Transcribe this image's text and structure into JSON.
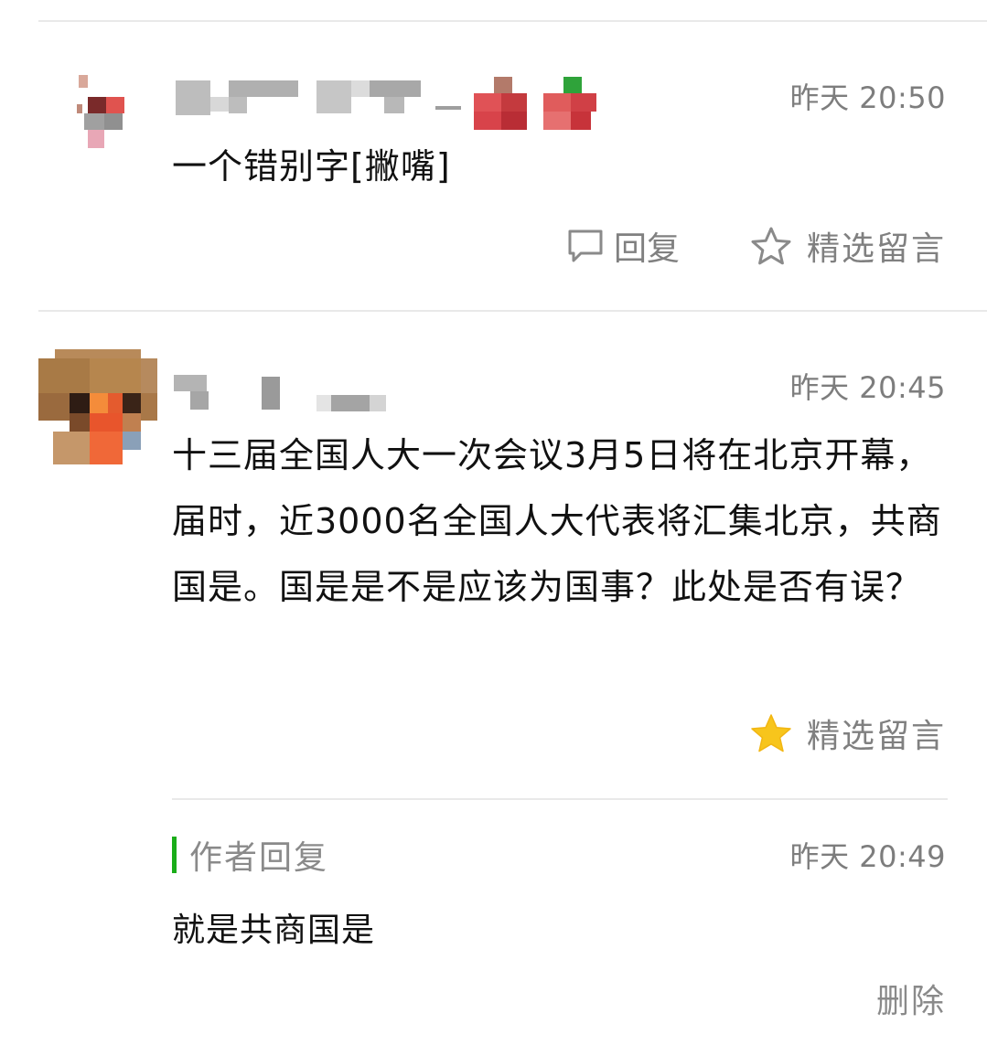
{
  "colors": {
    "background": "#ffffff",
    "text_primary": "#111111",
    "text_secondary": "#808080",
    "accent_green": "#1aad19",
    "star_gold": "#f7c51c",
    "divider": "#e9e9e9"
  },
  "comments": [
    {
      "author_name_blurred": true,
      "time": "昨天 20:50",
      "content": "一个错别字[撇嘴]",
      "actions": {
        "reply_label": "回复",
        "reply_icon": "comment-bubble-icon",
        "feature_label": "精选留言",
        "feature_icon": "star-outline-icon",
        "featured": false
      }
    },
    {
      "author_name_blurred": true,
      "time": "昨天 20:45",
      "content": "十三届全国人大一次会议3月5日将在北京开幕，届时，近3000名全国人大代表将汇集北京，共商国是。国是是不是应该为国事？此处是否有误？",
      "actions": {
        "feature_label": "精选留言",
        "feature_icon": "star-filled-icon",
        "featured": true
      },
      "author_reply": {
        "label": "作者回复",
        "time": "昨天 20:49",
        "content": "就是共商国是",
        "delete_label": "删除"
      }
    }
  ]
}
